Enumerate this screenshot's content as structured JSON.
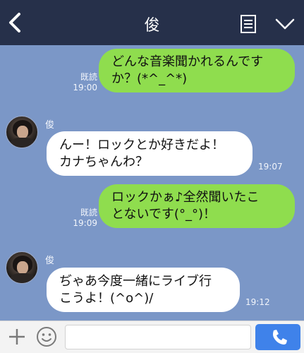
{
  "header": {
    "title": "俊"
  },
  "messages": [
    {
      "side": "right",
      "text_line1": "どんな音楽聞かれるんです",
      "text_line2": "か？(*^_^*)",
      "read_label": "既読",
      "time": "19:00"
    },
    {
      "side": "left",
      "sender": "俊",
      "text_line1": "んー！ロックとか好きだよ！",
      "text_line2": "カナちゃんわ？",
      "time": "19:07"
    },
    {
      "side": "right",
      "text_line1": "ロックかぁ♪全然聞いたこ",
      "text_line2": "とないです(°_°)！",
      "read_label": "既読",
      "time": "19:09"
    },
    {
      "side": "left",
      "sender": "俊",
      "text_line1": "ぢゃあ今度一緒にライブ行",
      "text_line2": "こうよ！(^o^)/",
      "time": "19:12"
    }
  ],
  "footer": {
    "input_value": "",
    "input_placeholder": ""
  },
  "colors": {
    "header_bg": "#26304a",
    "chat_bg": "#7b97c7",
    "sent_bubble": "#8fdd4e",
    "received_bubble": "#ffffff",
    "call_button": "#3f82ea"
  },
  "icons": [
    "back-arrow-icon",
    "notes-icon",
    "chevron-down-icon",
    "plus-icon",
    "emoji-icon",
    "phone-icon"
  ]
}
